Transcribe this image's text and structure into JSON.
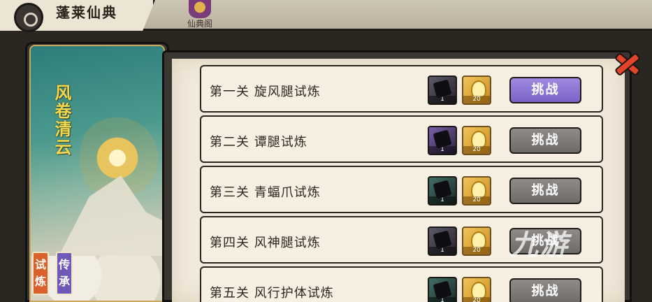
{
  "header": {
    "title": "蓬莱仙典",
    "tab_label": "仙典阁"
  },
  "card": {
    "title": "风卷清云",
    "tabs": [
      {
        "label": "试炼",
        "color": "#d8612c"
      },
      {
        "label": "传承",
        "color": "#6e58b8"
      }
    ]
  },
  "levels": [
    {
      "name": "第一关 旋风腿试炼",
      "item_a_count": "1",
      "item_b_count": "20",
      "button": "挑战",
      "active": true
    },
    {
      "name": "第二关 谭腿试炼",
      "item_a_count": "1",
      "item_b_count": "20",
      "button": "挑战",
      "active": false
    },
    {
      "name": "第三关 青蝠爪试炼",
      "item_a_count": "1",
      "item_b_count": "20",
      "button": "挑战",
      "active": false
    },
    {
      "name": "第四关 风神腿试炼",
      "item_a_count": "1",
      "item_b_count": "20",
      "button": "挑战",
      "active": false
    },
    {
      "name": "第五关 风行护体试炼",
      "item_a_count": "1",
      "item_b_count": "20",
      "button": "挑战",
      "active": false
    }
  ],
  "watermark": "九游",
  "colors": {
    "accent": "#7b62c8",
    "disabled": "#6d6a68",
    "close": "#e0442a"
  }
}
